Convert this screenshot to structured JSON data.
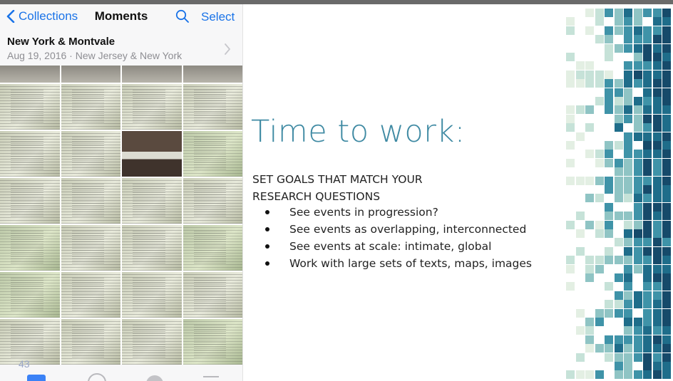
{
  "phone": {
    "nav": {
      "back_label": "Collections",
      "title": "Moments",
      "select_label": "Select"
    },
    "moment": {
      "title": "New York & Montvale",
      "subtitle": "Aug 19, 2016 · New Jersey & New York"
    },
    "photo_count": "43",
    "accent_color": "#1a73e8"
  },
  "slide": {
    "title": "Time to work:",
    "subhead_line1": "SET GOALS THAT MATCH YOUR",
    "subhead_line2": "RESEARCH QUESTIONS",
    "bullets": [
      "See events in progression?",
      "See events as overlapping, interconnected",
      "See events at scale: intimate, global",
      "Work with large sets of texts, maps, images"
    ],
    "title_color": "#3f8aa3"
  },
  "mosaic_palette": [
    "#e3efe3",
    "#c6e2d8",
    "#8fc4c4",
    "#3f93a8",
    "#1f6d8a",
    "#164a6a"
  ]
}
